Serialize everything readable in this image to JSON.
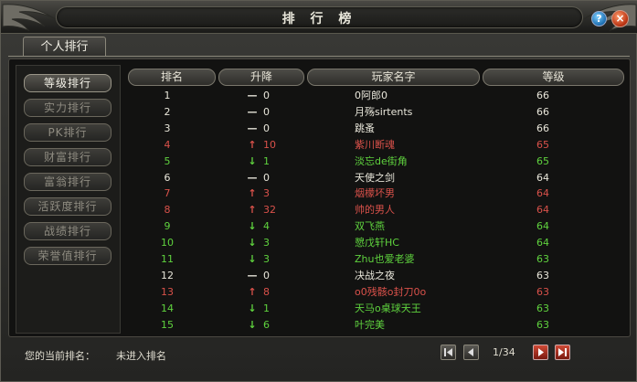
{
  "window": {
    "title": "排 行 榜",
    "help_label": "?",
    "close_label": "×"
  },
  "tabs": [
    {
      "label": "个人排行"
    }
  ],
  "sidebar": {
    "items": [
      {
        "label": "等级排行",
        "active": true
      },
      {
        "label": "实力排行",
        "active": false
      },
      {
        "label": "PK排行",
        "active": false
      },
      {
        "label": "财富排行",
        "active": false
      },
      {
        "label": "富翁排行",
        "active": false
      },
      {
        "label": "活跃度排行",
        "active": false
      },
      {
        "label": "战绩排行",
        "active": false
      },
      {
        "label": "荣誉值排行",
        "active": false
      }
    ]
  },
  "table": {
    "headers": {
      "rank": "排名",
      "change": "升降",
      "name": "玩家名字",
      "level": "等级"
    },
    "rows": [
      {
        "rank": "1",
        "trend": "none",
        "delta": "0",
        "name": "0阿郎0",
        "level": "66",
        "color": "white"
      },
      {
        "rank": "2",
        "trend": "none",
        "delta": "0",
        "name": "月殇sirtents",
        "level": "66",
        "color": "white"
      },
      {
        "rank": "3",
        "trend": "none",
        "delta": "0",
        "name": "跳蚤",
        "level": "66",
        "color": "white"
      },
      {
        "rank": "4",
        "trend": "up",
        "delta": "10",
        "name": "紫川断魂",
        "level": "65",
        "color": "red"
      },
      {
        "rank": "5",
        "trend": "down",
        "delta": "1",
        "name": "淡忘de街角",
        "level": "65",
        "color": "green"
      },
      {
        "rank": "6",
        "trend": "none",
        "delta": "0",
        "name": "天使之剑",
        "level": "64",
        "color": "white"
      },
      {
        "rank": "7",
        "trend": "up",
        "delta": "3",
        "name": "烟檬坏男",
        "level": "64",
        "color": "red"
      },
      {
        "rank": "8",
        "trend": "up",
        "delta": "32",
        "name": "帅的男人",
        "level": "64",
        "color": "red"
      },
      {
        "rank": "9",
        "trend": "down",
        "delta": "4",
        "name": "双飞燕",
        "level": "64",
        "color": "green"
      },
      {
        "rank": "10",
        "trend": "down",
        "delta": "3",
        "name": "㦝戊轩HC",
        "level": "64",
        "color": "green"
      },
      {
        "rank": "11",
        "trend": "down",
        "delta": "3",
        "name": "Zhu也爱老婆",
        "level": "63",
        "color": "green"
      },
      {
        "rank": "12",
        "trend": "none",
        "delta": "0",
        "name": "决战之夜",
        "level": "63",
        "color": "white"
      },
      {
        "rank": "13",
        "trend": "up",
        "delta": "8",
        "name": "o0残骸o封刀0o",
        "level": "63",
        "color": "red"
      },
      {
        "rank": "14",
        "trend": "down",
        "delta": "1",
        "name": "天马o桌球天王",
        "level": "63",
        "color": "green"
      },
      {
        "rank": "15",
        "trend": "down",
        "delta": "6",
        "name": "叶完美",
        "level": "63",
        "color": "green"
      }
    ]
  },
  "status": {
    "label": "您的当前排名：",
    "value": "未进入排名"
  },
  "pagination": {
    "page": "1/34"
  },
  "colors": {
    "white": "#e8e6da",
    "red": "#d9514a",
    "green": "#5fd23e"
  },
  "trend_glyphs": {
    "none": "—",
    "up": "↑",
    "down": "↓"
  }
}
